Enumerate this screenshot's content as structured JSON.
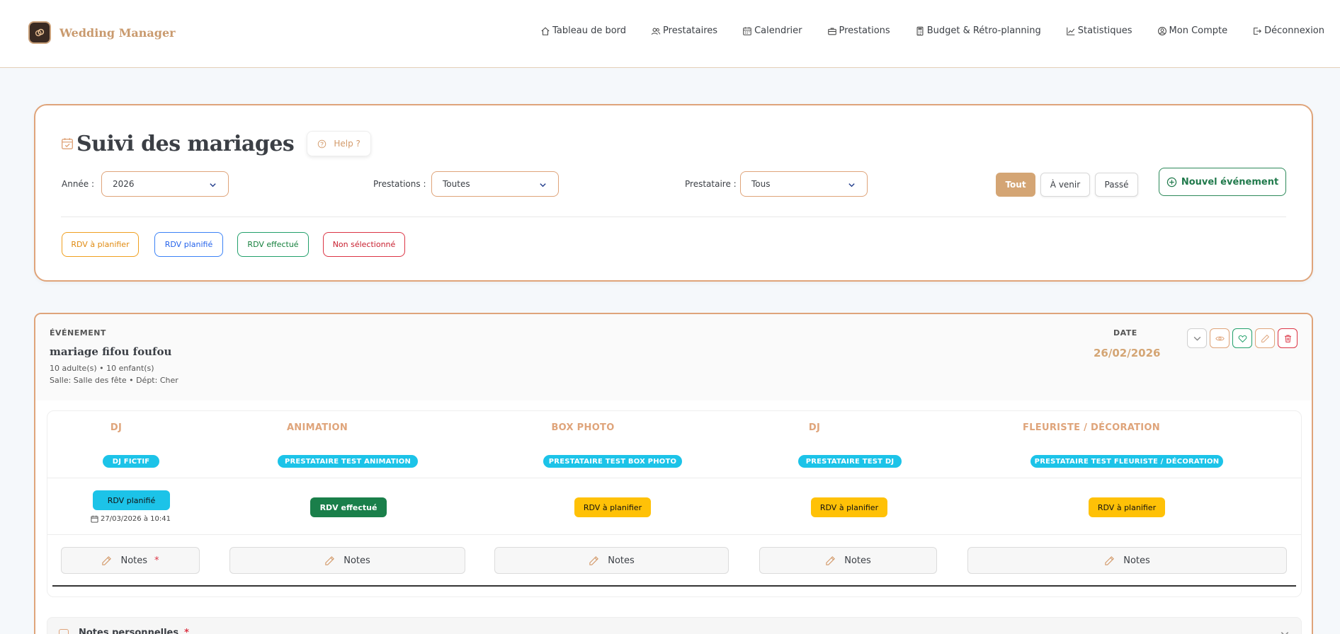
{
  "brand": {
    "name": "Wedding Manager"
  },
  "nav": [
    {
      "label": "Tableau de bord",
      "icon": "home-icon"
    },
    {
      "label": "Prestataires",
      "icon": "users-icon"
    },
    {
      "label": "Calendrier",
      "icon": "calendar-icon"
    },
    {
      "label": "Prestations",
      "icon": "briefcase-icon"
    },
    {
      "label": "Budget & Rétro-planning",
      "icon": "calculator-icon"
    },
    {
      "label": "Statistiques",
      "icon": "chart-line-icon"
    },
    {
      "label": "Mon Compte",
      "icon": "user-circle-icon"
    },
    {
      "label": "Déconnexion",
      "icon": "logout-icon"
    }
  ],
  "filters": {
    "title": "Suivi des mariages",
    "help_label": "Help ?",
    "year_label": "Année :",
    "year_value": "2026",
    "prestations_label": "Prestations :",
    "prestations_value": "Toutes",
    "prestataire_label": "Prestataire :",
    "prestataire_value": "Tous",
    "periods": [
      "Tout",
      "À venir",
      "Passé"
    ],
    "active_period": "Tout",
    "new_event_label": "Nouvel événement"
  },
  "legend": [
    {
      "label": "RDV à planifier",
      "color": "#f0a020"
    },
    {
      "label": "RDV planifié",
      "color": "#3b82f6"
    },
    {
      "label": "RDV effectué",
      "color": "#22a06b"
    },
    {
      "label": "Non sélectionné",
      "color": "#dc3545"
    }
  ],
  "event": {
    "section_label": "ÉVÉNEMENT",
    "name": "mariage fifou foufou",
    "guests": "10 adulte(s) • 10 enfant(s)",
    "venue": "Salle: Salle des fête • Dépt: Cher",
    "date_label": "DATE",
    "date": "26/02/2026",
    "actions": [
      "chevron-down-icon",
      "eye-icon",
      "heart-icon",
      "pencil-icon",
      "trash-icon"
    ],
    "prestations": [
      {
        "category": "DJ",
        "provider": "DJ FICTIF",
        "status": "RDV planifié",
        "status_type": "planifie",
        "rdv_date": "27/03/2026 à 10:41",
        "notes": "Notes",
        "required": true
      },
      {
        "category": "ANIMATION",
        "provider": "PRESTATAIRE TEST ANIMATION",
        "status": "RDV effectué",
        "status_type": "effectue",
        "notes": "Notes",
        "required": false
      },
      {
        "category": "BOX PHOTO",
        "provider": "PRESTATAIRE TEST BOX PHOTO",
        "status": "RDV à planifier",
        "status_type": "aplanifier",
        "notes": "Notes",
        "required": false
      },
      {
        "category": "DJ",
        "provider": "PRESTATAIRE TEST DJ",
        "status": "RDV à planifier",
        "status_type": "aplanifier",
        "notes": "Notes",
        "required": false
      },
      {
        "category": "FLEURISTE / DÉCORATION",
        "provider": "PRESTATAIRE TEST FLEURISTE / DÉCORATION",
        "status": "RDV à planifier",
        "status_type": "aplanifier",
        "notes": "Notes",
        "required": false
      }
    ],
    "notes_section_label": "Notes personnelles",
    "notes_required_marker": "*"
  },
  "colors": {
    "accent": "#d4a574",
    "border": "#dfa47a",
    "cyan": "#1cc3e8",
    "green": "#1a7f4a",
    "yellow": "#ffc107"
  }
}
